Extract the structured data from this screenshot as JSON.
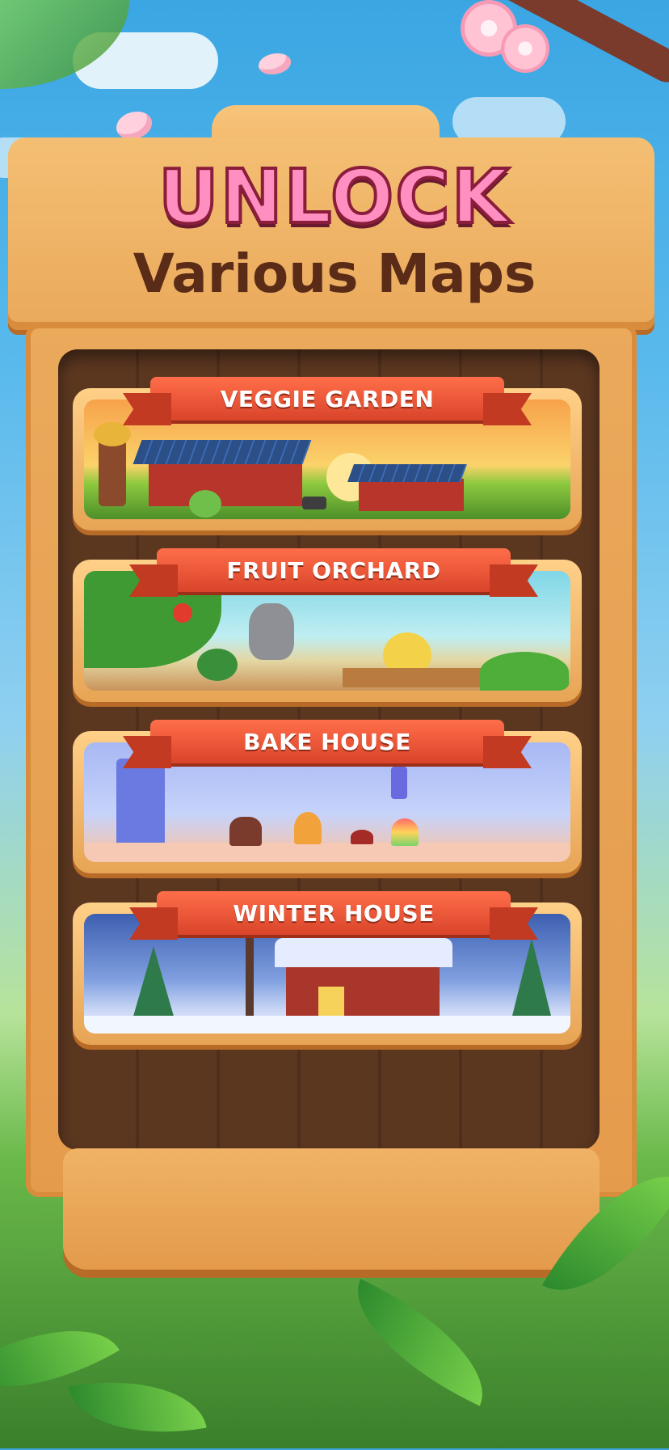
{
  "header": {
    "title": "UNLOCK",
    "subtitle": "Various Maps"
  },
  "maps": [
    {
      "label": "VEGGIE GARDEN"
    },
    {
      "label": "FRUIT ORCHARD"
    },
    {
      "label": "BAKE HOUSE"
    },
    {
      "label": "WINTER HOUSE"
    }
  ],
  "colors": {
    "sky": "#3aa6e3",
    "board": "#eaa95b",
    "ribbon": "#e5512f",
    "title_pink": "#ff8fc1",
    "title_brown": "#5a2b17"
  }
}
